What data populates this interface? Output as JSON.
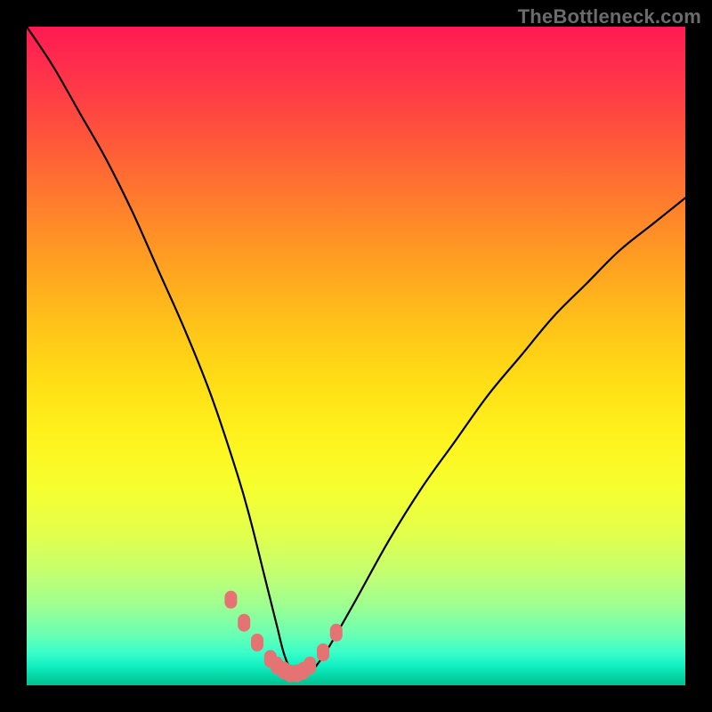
{
  "credit": "TheBottleneck.com",
  "colors": {
    "curve_stroke": "#000000",
    "marker_fill": "#e57373",
    "marker_stroke": "#e57373",
    "frame_bg": "#000000"
  },
  "chart_data": {
    "type": "line",
    "title": "",
    "xlabel": "",
    "ylabel": "",
    "xlim": [
      0,
      100
    ],
    "ylim": [
      0,
      100
    ],
    "grid": false,
    "series": [
      {
        "name": "bottleneck-curve",
        "x": [
          0,
          4,
          8,
          12,
          16,
          20,
          24,
          28,
          32,
          34,
          36,
          37,
          38,
          39,
          40,
          41,
          42,
          43,
          44,
          46,
          50,
          55,
          60,
          65,
          70,
          75,
          80,
          85,
          90,
          95,
          100
        ],
        "values": [
          100,
          94,
          87,
          80,
          72,
          63,
          54,
          44,
          32,
          25,
          17,
          13,
          9,
          5,
          2.5,
          1.5,
          1.5,
          2,
          3,
          6,
          13,
          22,
          30,
          37,
          44,
          50,
          56,
          61,
          66,
          70,
          74
        ]
      }
    ],
    "markers": {
      "name": "highlight-points",
      "x": [
        31,
        33,
        35,
        37,
        38,
        39,
        40,
        41,
        42,
        43,
        45,
        47
      ],
      "values": [
        13,
        9.5,
        6.5,
        4,
        3,
        2.3,
        1.8,
        1.8,
        2.2,
        3,
        5,
        8
      ]
    }
  }
}
